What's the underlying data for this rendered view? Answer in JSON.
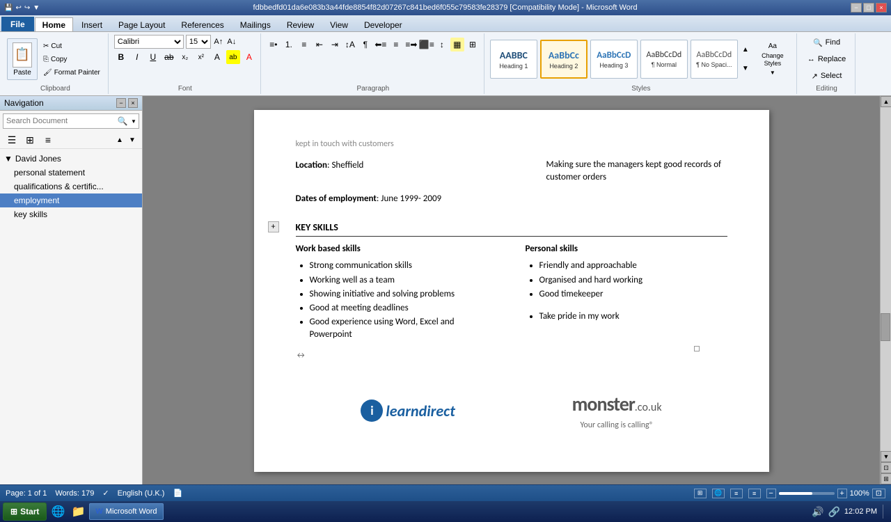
{
  "titlebar": {
    "title": "fdbbedfd01da6e083b3a44fde8854f82d07267c841bed6f055c79583fe28379 [Compatibility Mode] - Microsoft Word",
    "controls": [
      "−",
      "□",
      "×"
    ]
  },
  "ribbon": {
    "tabs": [
      "File",
      "Home",
      "Insert",
      "Page Layout",
      "References",
      "Mailings",
      "Review",
      "View",
      "Developer"
    ],
    "active_tab": "Home",
    "groups": {
      "clipboard": {
        "label": "Clipboard",
        "paste": "Paste",
        "cut": "Cut",
        "copy": "Copy",
        "format_painter": "Format Painter"
      },
      "font": {
        "label": "Font",
        "font_name": "Calibri",
        "font_size": "15"
      },
      "paragraph": {
        "label": "Paragraph"
      },
      "styles": {
        "label": "Styles",
        "items": [
          {
            "id": "h1",
            "preview": "AaBbCc",
            "label": "Heading 1"
          },
          {
            "id": "h2",
            "preview": "AaBbCc",
            "label": "Heading 2",
            "active": true
          },
          {
            "id": "h3",
            "preview": "AaBbCcD",
            "label": "Heading 3"
          },
          {
            "id": "normal",
            "preview": "AaBbCcDd",
            "label": "¶ Normal"
          },
          {
            "id": "nospace",
            "preview": "AaBbCcDd",
            "label": "¶ No Spaci..."
          }
        ],
        "change_styles": "Change Styles"
      },
      "editing": {
        "label": "Editing",
        "find": "Find",
        "replace": "Replace",
        "select": "Select"
      }
    }
  },
  "navigation": {
    "title": "Navigation",
    "search_placeholder": "Search Document",
    "tree": [
      {
        "id": "david-jones",
        "label": "David Jones",
        "type": "parent",
        "expanded": true
      },
      {
        "id": "personal-statement",
        "label": "personal statement",
        "type": "child"
      },
      {
        "id": "qualifications",
        "label": "qualifications & certific...",
        "type": "child"
      },
      {
        "id": "employment",
        "label": "employment",
        "type": "child",
        "active": true
      },
      {
        "id": "key-skills",
        "label": "key skills",
        "type": "child"
      }
    ]
  },
  "document": {
    "fields": [
      {
        "label": "Location",
        "value": ": Sheffield"
      },
      {
        "label": "Dates of employment",
        "value": ": June 1999- 2009"
      }
    ],
    "section_header": "KEY SKILLS",
    "work_skills": {
      "header": "Work based skills",
      "items": [
        "Strong communication skills",
        "Working well as a team",
        "Showing initiative and solving problems",
        "Good at meeting deadlines",
        "Good experience using Word, Excel and Powerpoint"
      ]
    },
    "personal_skills": {
      "header": "Personal skills",
      "items": [
        "Friendly and approachable",
        "Organised and hard working",
        "Good timekeeper",
        "",
        "Take pride in my work"
      ]
    },
    "logos": {
      "learndirect": "learndirect",
      "monster_main": "monster",
      "monster_domain": ".co.uk",
      "monster_tagline": "Your calling is calling®"
    }
  },
  "statusbar": {
    "page": "Page: 1 of 1",
    "words": "Words: 179",
    "language": "English (U.K.)",
    "zoom": "100%"
  },
  "taskbar": {
    "start": "Start",
    "time": "12:02 PM",
    "active_app": "Microsoft Word"
  }
}
